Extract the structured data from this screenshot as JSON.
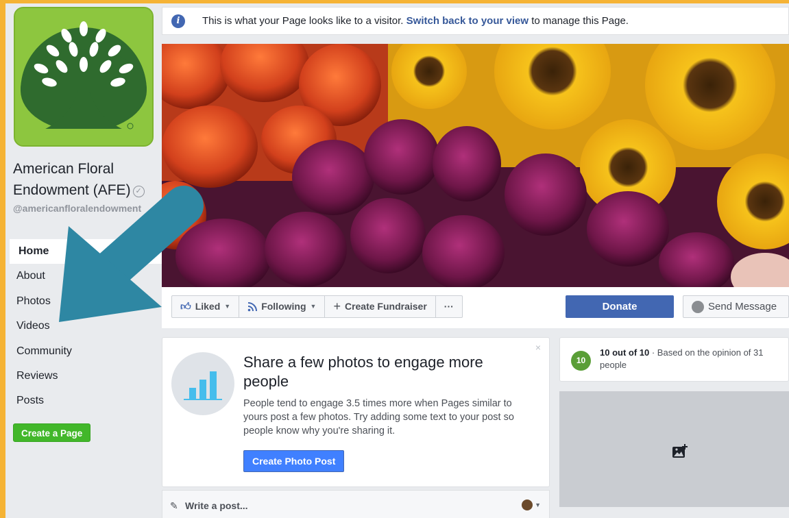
{
  "banner": {
    "prefix": "This is what your Page looks like to a visitor.",
    "link": "Switch back to your view",
    "suffix": "to manage this Page."
  },
  "page": {
    "name": "American Floral Endowment (AFE)",
    "handle": "@americanfloralendowment"
  },
  "nav": {
    "items": [
      "Home",
      "About",
      "Photos",
      "Videos",
      "Community",
      "Reviews",
      "Posts"
    ],
    "create_page": "Create a Page"
  },
  "actions": {
    "liked": "Liked",
    "following": "Following",
    "fundraiser": "Create Fundraiser",
    "more": "···",
    "donate": "Donate",
    "send_message": "Send Message"
  },
  "card": {
    "close": "×",
    "title": "Share a few photos to engage more people",
    "body": "People tend to engage 3.5 times more when Pages similar to yours post a few photos. Try adding some text to your post so people know why you're sharing it.",
    "button": "Create Photo Post"
  },
  "composer": {
    "placeholder": "Write a post..."
  },
  "rating": {
    "badge": "10",
    "score": "10 out of 10",
    "detail": " · Based on the opinion of 31 people"
  },
  "colors": {
    "facebook_blue": "#4267b2",
    "create_page_green": "#42b72a",
    "logo_green": "#8dc63f",
    "arrow": "#2e87a3",
    "frame_orange": "#f5b335"
  }
}
